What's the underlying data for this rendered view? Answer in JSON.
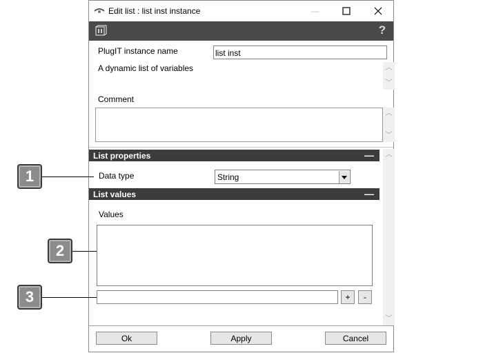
{
  "window": {
    "title": "Edit list : list inst instance",
    "minimize": "—",
    "maximize": "☐",
    "close": "✕"
  },
  "toolbar": {
    "help": "?"
  },
  "form": {
    "instance_name_label": "PlugIT instance name",
    "instance_name_value": "list inst",
    "description": "A dynamic list of variables",
    "comment_label": "Comment",
    "comment_value": ""
  },
  "list_properties": {
    "header": "List properties",
    "collapse": "—",
    "data_type_label": "Data type",
    "data_type_value": "String"
  },
  "list_values": {
    "header": "List values",
    "collapse": "—",
    "values_label": "Values",
    "new_value": "",
    "add": "+",
    "remove": "-"
  },
  "footer": {
    "ok": "Ok",
    "apply": "Apply",
    "cancel": "Cancel"
  },
  "callouts": [
    "1",
    "2",
    "3"
  ],
  "colors": {
    "dark_bar": "#3c3c3c",
    "callout_fill": "#8c8c8c"
  }
}
